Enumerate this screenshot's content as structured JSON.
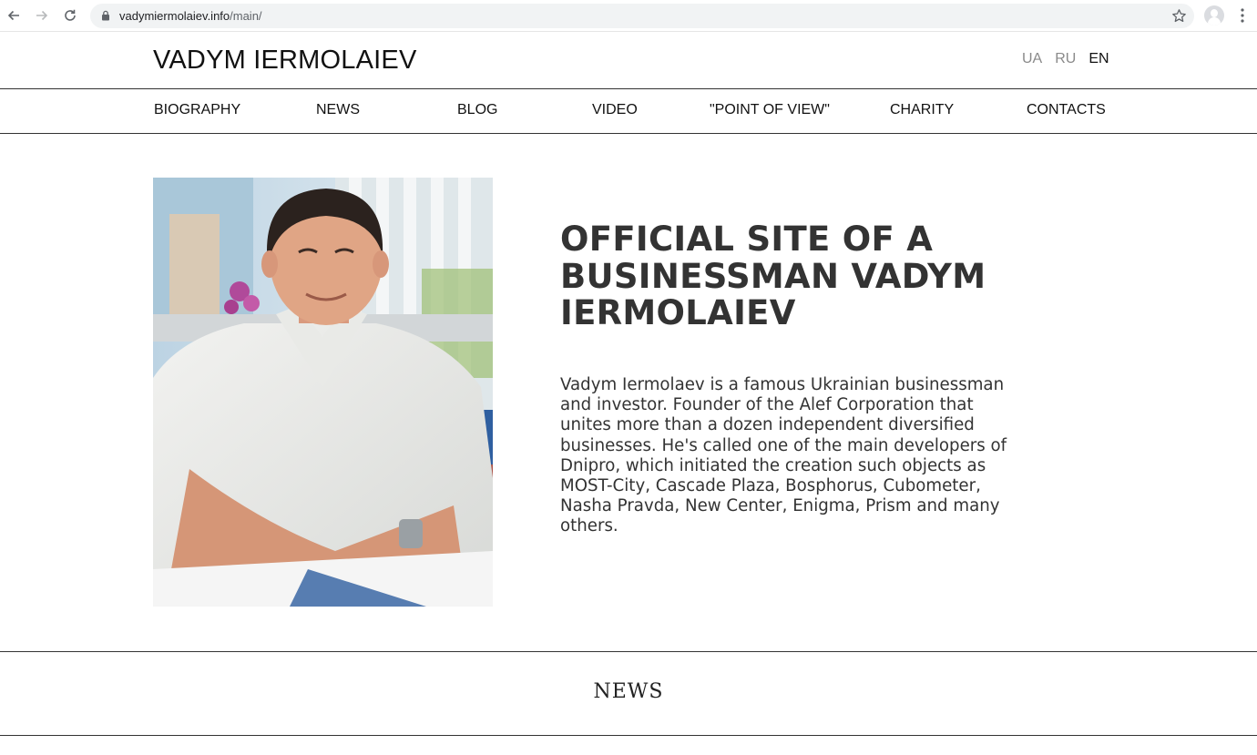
{
  "browser": {
    "url_host": "vadymiermolaiev.info",
    "url_path": "/main/",
    "icons": [
      "back-arrow-icon",
      "forward-arrow-icon",
      "reload-icon",
      "lock-icon",
      "bookmark-star-icon",
      "profile-icon",
      "more-menu-icon"
    ]
  },
  "header": {
    "site_title": "VADYM IERMOLAIEV",
    "languages": [
      {
        "code": "UA",
        "active": false
      },
      {
        "code": "RU",
        "active": false
      },
      {
        "code": "EN",
        "active": true
      }
    ]
  },
  "nav": {
    "items": [
      {
        "label": "BIOGRAPHY"
      },
      {
        "label": "NEWS"
      },
      {
        "label": "BLOG"
      },
      {
        "label": "VIDEO"
      },
      {
        "label": "\"POINT OF VIEW\""
      },
      {
        "label": "CHARITY"
      },
      {
        "label": "CONTACTS"
      }
    ]
  },
  "hero": {
    "title": "OFFICIAL SITE OF A BUSINESSMAN VADYM IERMOLAIEV",
    "description": "Vadym Iermolaev is a famous Ukrainian businessman and investor. Founder of the Alef Corporation that unites more than a dozen independent diversified businesses. He's called one of the main developers of Dnipro, which initiated the creation such objects as MOST-City, Cascade Plaza, Bosphorus, Cubometer, Nasha Pravda, New Center, Enigma, Prism and many others."
  },
  "news_section": {
    "heading": "NEWS"
  },
  "colors": {
    "text": "#222222",
    "inactive_lang": "#8a8a8a",
    "rule": "#333333",
    "omnibox": "#f1f3f4"
  }
}
